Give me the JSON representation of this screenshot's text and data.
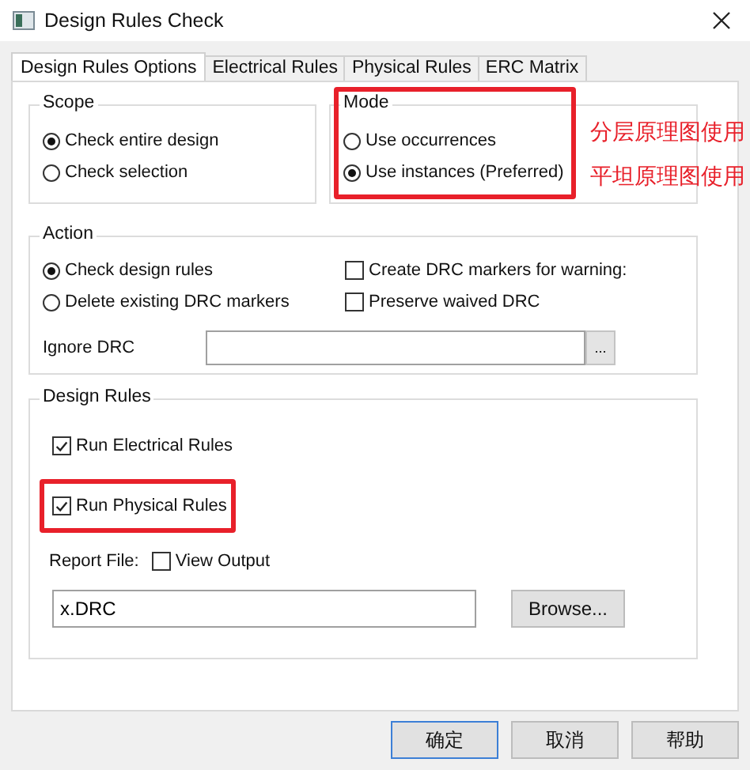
{
  "window": {
    "title": "Design Rules Check"
  },
  "tabs": [
    {
      "label": "Design Rules Options",
      "selected": true
    },
    {
      "label": "Electrical Rules",
      "selected": false
    },
    {
      "label": "Physical Rules",
      "selected": false
    },
    {
      "label": "ERC Matrix",
      "selected": false
    }
  ],
  "scope": {
    "title": "Scope",
    "options": [
      {
        "label": "Check entire design",
        "selected": true
      },
      {
        "label": "Check selection",
        "selected": false
      }
    ]
  },
  "mode": {
    "title": "Mode",
    "highlighted": true,
    "options": [
      {
        "label": "Use occurrences",
        "selected": false,
        "note": "分层原理图使用"
      },
      {
        "label": "Use instances (Preferred)",
        "selected": true,
        "note": "平坦原理图使用"
      }
    ]
  },
  "action": {
    "title": "Action",
    "options": [
      {
        "label": "Check design rules",
        "selected": true
      },
      {
        "label": "Delete existing DRC markers",
        "selected": false
      }
    ],
    "checks": [
      {
        "label": "Create DRC markers for warning:",
        "checked": false
      },
      {
        "label": "Preserve waived DRC",
        "checked": false
      }
    ],
    "ignore_drc": {
      "label": "Ignore DRC",
      "button": "..."
    }
  },
  "design_rules": {
    "title": "Design Rules",
    "checks": [
      {
        "label": "Run Electrical Rules",
        "checked": true,
        "highlighted": false
      },
      {
        "label": "Run Physical Rules",
        "checked": true,
        "highlighted": true
      }
    ],
    "report_file": {
      "label": "Report File:",
      "view_output": {
        "label": "View Output",
        "checked": false
      },
      "value": "x.DRC",
      "button": "Browse..."
    }
  },
  "buttons": [
    {
      "label": "确定",
      "default": true
    },
    {
      "label": "取消",
      "default": false
    },
    {
      "label": "帮助",
      "default": false
    }
  ]
}
